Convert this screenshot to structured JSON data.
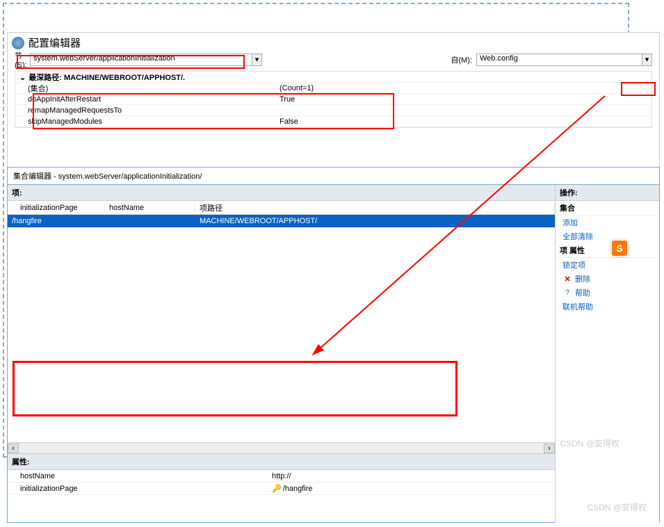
{
  "editor": {
    "title": "配置编辑器",
    "section_label": "节(S):",
    "section_value": "system.webServer/applicationInitialization",
    "from_label": "自(M):",
    "from_value": "Web.config",
    "path_label": "最深路径: MACHINE/WEBROOT/APPHOST/.",
    "rows": [
      {
        "k": "(集合)",
        "v": "(Count=1)"
      },
      {
        "k": "doAppInitAfterRestart",
        "v": "True"
      },
      {
        "k": "remapManagedRequestsTo",
        "v": ""
      },
      {
        "k": "skipManagedModules",
        "v": "False"
      }
    ]
  },
  "dialog": {
    "title": "集合编辑器 - system.webServer/applicationInitialization/",
    "items_label": "项:",
    "headers": {
      "c1": "initializationPage",
      "c2": "hostName",
      "c3": "项路径"
    },
    "row": {
      "c1": "/hangfire",
      "c2": "",
      "c3": "MACHINE/WEBROOT/APPHOST/"
    },
    "props_label": "属性:",
    "props": [
      {
        "k": "hostName",
        "v": "http://"
      },
      {
        "k": "initializationPage",
        "v": "/hangfire",
        "key": true
      }
    ]
  },
  "actions": {
    "header": "操作:",
    "collection": "集合",
    "add": "添加",
    "remove_all": "全部清除",
    "item_props": "项 属性",
    "lock": "锁定项",
    "delete": "删除",
    "help": "帮助",
    "online_help": "联机帮助"
  },
  "sogou": "S",
  "watermark": "CSDN @安得权"
}
